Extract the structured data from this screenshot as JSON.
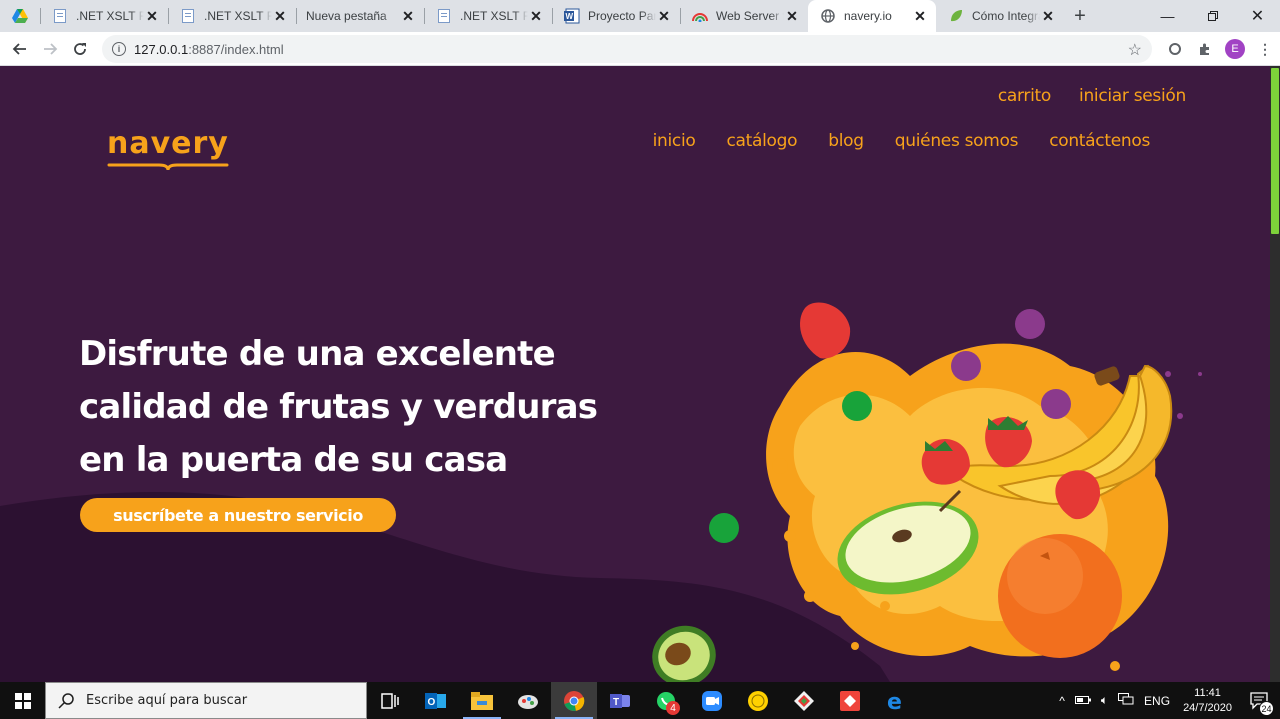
{
  "browser": {
    "tabs": [
      {
        "title": "",
        "favicon": "google-drive-icon",
        "active": false
      },
      {
        "title": ".NET XSLT Fiddle",
        "favicon": "document-icon",
        "active": false
      },
      {
        "title": ".NET XSLT Fiddle",
        "favicon": "document-icon",
        "active": false
      },
      {
        "title": "Nueva pestaña",
        "favicon": "none",
        "active": false
      },
      {
        "title": ".NET XSLT Fiddle",
        "favicon": "document-icon",
        "active": false
      },
      {
        "title": "Proyecto Parcial",
        "favicon": "word-icon",
        "active": false
      },
      {
        "title": "Web Server for Chrome",
        "favicon": "web-server-icon",
        "active": false
      },
      {
        "title": "navery.io",
        "favicon": "globe-icon",
        "active": true
      },
      {
        "title": "Cómo Integrar",
        "favicon": "leaf-icon",
        "active": false
      }
    ],
    "url_host": "127.0.0.1",
    "url_path": ":8887/index.html",
    "profile_initial": "E"
  },
  "site": {
    "logo": "navery",
    "top_links": [
      "carrito",
      "iniciar sesión"
    ],
    "main_links": [
      "inicio",
      "catálogo",
      "blog",
      "quiénes somos",
      "contáctenos"
    ],
    "hero_lines": [
      "Disfrute de una excelente",
      "calidad de frutas y verduras",
      "en la puerta de su casa"
    ],
    "cta": "suscríbete a nuestro servicio",
    "colors": {
      "accent": "#f7a21b",
      "background": "#3d1a40",
      "background_dark": "#2a1230"
    }
  },
  "taskbar": {
    "search_placeholder": "Escribe aquí para buscar",
    "whatsapp_badge": "4",
    "language": "ENG",
    "time": "11:41",
    "date": "24/7/2020",
    "notifications": "24"
  }
}
